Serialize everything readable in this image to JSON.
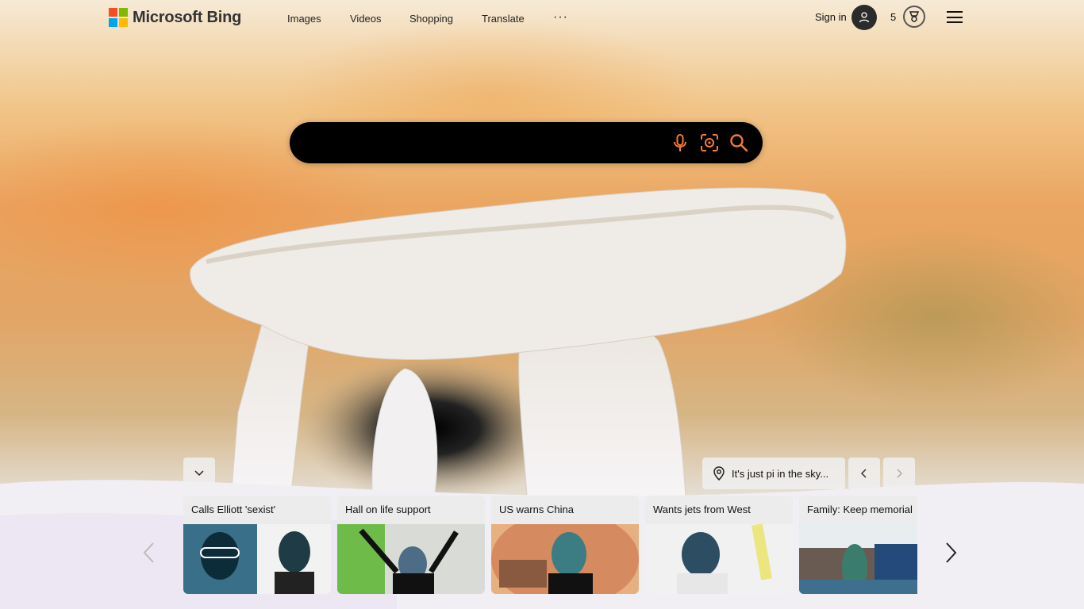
{
  "brand": {
    "logo_text": "Microsoft Bing",
    "colors": [
      "#f25022",
      "#7fba00",
      "#00a4ef",
      "#ffb900"
    ]
  },
  "nav": {
    "items": [
      "Images",
      "Videos",
      "Shopping",
      "Translate"
    ],
    "more_label": "···"
  },
  "account": {
    "signin_label": "Sign in",
    "rewards_points": "5"
  },
  "search": {
    "placeholder": "",
    "value": "",
    "accent": "#f47a3a"
  },
  "image_info": {
    "location_caption": "It's just pi in the sky..."
  },
  "news": {
    "cards": [
      {
        "title": "Calls Elliott 'sexist'"
      },
      {
        "title": "Hall on life support"
      },
      {
        "title": "US warns China"
      },
      {
        "title": "Wants jets from West"
      },
      {
        "title": "Family: Keep memorial"
      }
    ]
  },
  "icons": [
    "microphone-icon",
    "visual-search-icon",
    "search-icon",
    "chevron-down-icon",
    "location-pin-icon",
    "chevron-left-icon",
    "chevron-right-icon",
    "user-icon",
    "rewards-icon",
    "hamburger-menu-icon"
  ]
}
